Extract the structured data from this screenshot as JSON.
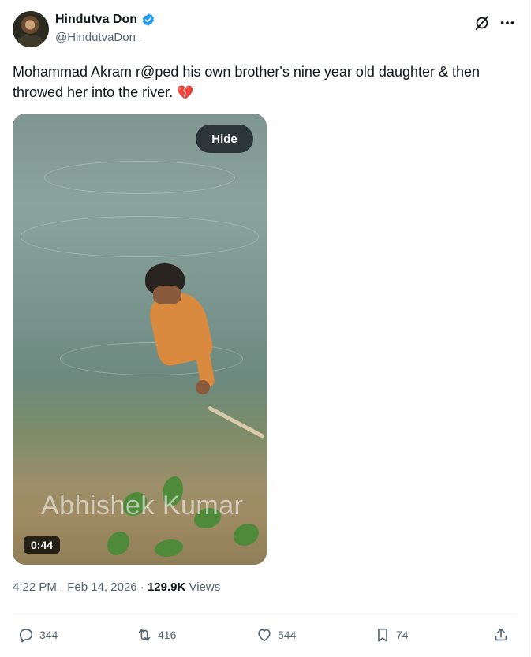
{
  "author": {
    "display_name": "Hindutva Don",
    "handle": "@HindutvaDon_",
    "verified": true,
    "avatar_icon": "profile-avatar"
  },
  "header_actions": {
    "grok_icon": "grok-icon",
    "more_icon": "more-horizontal-icon"
  },
  "tweet": {
    "text": "Mohammad Akram r@ped his own brother's nine year old daughter & then throwed her into the river.",
    "emoji": "💔"
  },
  "media": {
    "hide_label": "Hide",
    "watermark": "Abhishek Kumar",
    "duration": "0:44"
  },
  "meta": {
    "time": "4:22 PM",
    "separator": "·",
    "date": "Feb 14, 2026",
    "views_count": "129.9K",
    "views_label": "Views"
  },
  "actions": {
    "replies": "344",
    "reposts": "416",
    "likes": "544",
    "bookmarks": "74"
  },
  "colors": {
    "text_primary": "#0f1419",
    "text_secondary": "#536471",
    "verified_blue": "#1d9bf0",
    "divider": "#eff3f4"
  }
}
